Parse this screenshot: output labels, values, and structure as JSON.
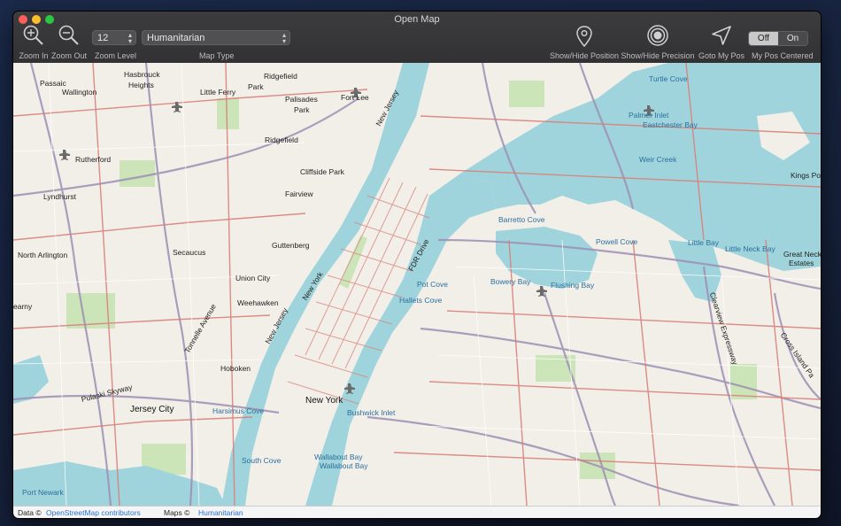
{
  "window": {
    "title": "Open Map"
  },
  "toolbar": {
    "zoom_in": "Zoom In",
    "zoom_out": "Zoom Out",
    "zoom_level_label": "Zoom Level",
    "zoom_level_value": "12",
    "map_type_label": "Map Type",
    "map_type_value": "Humanitarian",
    "show_hide_position": "Show/Hide Position",
    "show_hide_precision": "Show/Hide Precision",
    "goto_my_pos": "Goto My Pos",
    "my_pos_centered": "My Pos Centered",
    "toggle_off": "Off",
    "toggle_on": "On"
  },
  "icons": {
    "zoom_in": "zoom-in-icon",
    "zoom_out": "zoom-out-icon",
    "position": "map-pin-icon",
    "precision": "target-icon",
    "goto": "navigation-arrow-icon"
  },
  "colors": {
    "map_background": "#f2efe9",
    "water": "#9fd4dc",
    "primary_road": "#d9807a",
    "secondary_road": "#9e8fb4",
    "park": "#c8e3b3"
  },
  "map": {
    "labels": [
      {
        "text": "Passaic",
        "type": "place"
      },
      {
        "text": "Wallington",
        "type": "place"
      },
      {
        "text": "Hasbrouck",
        "type": "place"
      },
      {
        "text": "Heights",
        "type": "place"
      },
      {
        "text": "Little Ferry",
        "type": "place"
      },
      {
        "text": "Ridgefield",
        "type": "place"
      },
      {
        "text": "Park",
        "type": "place"
      },
      {
        "text": "Palisades",
        "type": "place"
      },
      {
        "text": "Park",
        "type": "place"
      },
      {
        "text": "Fort Lee",
        "type": "place"
      },
      {
        "text": "Rutherford",
        "type": "place"
      },
      {
        "text": "Ridgefield",
        "type": "place"
      },
      {
        "text": "Cliffside Park",
        "type": "place"
      },
      {
        "text": "Fairview",
        "type": "place"
      },
      {
        "text": "Lyndhurst",
        "type": "place"
      },
      {
        "text": "North Arlington",
        "type": "place"
      },
      {
        "text": "Secaucus",
        "type": "place"
      },
      {
        "text": "Guttenberg",
        "type": "place"
      },
      {
        "text": "Union City",
        "type": "place"
      },
      {
        "text": "Weehawken",
        "type": "place"
      },
      {
        "text": "Hoboken",
        "type": "place"
      },
      {
        "text": "earny",
        "type": "place"
      },
      {
        "text": "Pulaski Skyway",
        "type": "road"
      },
      {
        "text": "Jersey City",
        "type": "big"
      },
      {
        "text": "Harsimus Cove",
        "type": "water"
      },
      {
        "text": "New York",
        "type": "big"
      },
      {
        "text": "Bushwick Inlet",
        "type": "water"
      },
      {
        "text": "South Cove",
        "type": "water"
      },
      {
        "text": "Wallabout Bay",
        "type": "water"
      },
      {
        "text": "Wallabout Bay",
        "type": "water"
      },
      {
        "text": "Port Newark",
        "type": "water"
      },
      {
        "text": "Turtle Cove",
        "type": "water"
      },
      {
        "text": "Palmer Inlet",
        "type": "water"
      },
      {
        "text": "Eastchester Bay",
        "type": "water"
      },
      {
        "text": "Weir Creek",
        "type": "water"
      },
      {
        "text": "Kings Poi",
        "type": "place"
      },
      {
        "text": "Barretto Cove",
        "type": "water"
      },
      {
        "text": "Powell Cove",
        "type": "water"
      },
      {
        "text": "Little Bay",
        "type": "water"
      },
      {
        "text": "Little Neck Bay",
        "type": "water"
      },
      {
        "text": "Great Neck",
        "type": "place"
      },
      {
        "text": "Estates",
        "type": "place"
      },
      {
        "text": "Pot Cove",
        "type": "water"
      },
      {
        "text": "Bowery Bay",
        "type": "water"
      },
      {
        "text": "Flushing Bay",
        "type": "water"
      },
      {
        "text": "Hallets Cove",
        "type": "water"
      },
      {
        "text": "FDR Drive",
        "type": "road"
      },
      {
        "text": "New York",
        "type": "road"
      },
      {
        "text": "New Jersey",
        "type": "road"
      },
      {
        "text": "New Jersey",
        "type": "road"
      },
      {
        "text": "Tonnelle Avenue",
        "type": "road"
      },
      {
        "text": "Clearview Expressway",
        "type": "road"
      },
      {
        "text": "Cross Island Pa",
        "type": "road"
      }
    ]
  },
  "footer": {
    "data_prefix": "Data ©",
    "data_link": "OpenStreetMap contributors",
    "maps_prefix": "Maps ©",
    "maps_link": "Humanitarian"
  }
}
